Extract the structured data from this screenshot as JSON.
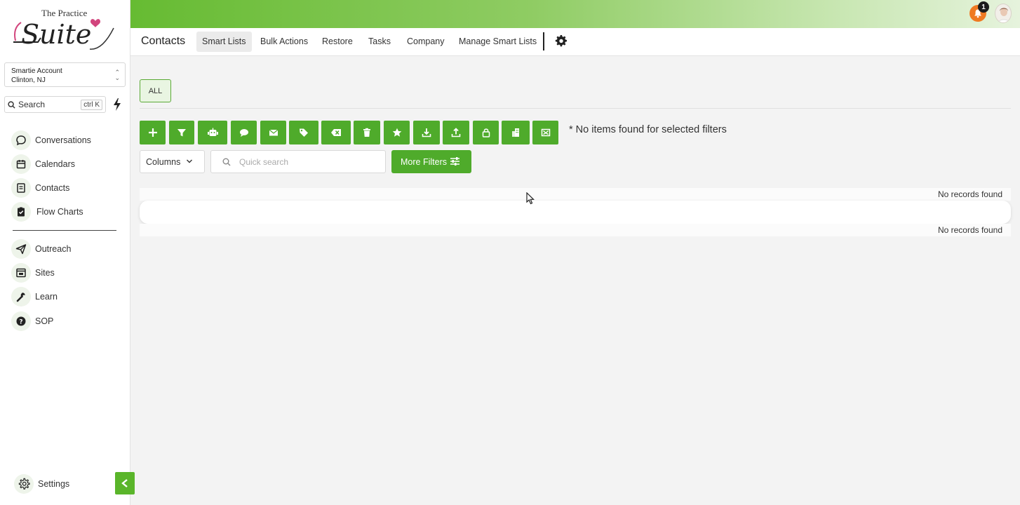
{
  "brand": {
    "logo_top_text": "The Practice",
    "logo_script_text": "Suite",
    "accent": "#4fab2b"
  },
  "account": {
    "name": "Smartie Account",
    "location": "Clinton, NJ"
  },
  "search": {
    "label": "Search",
    "shortcut": "ctrl K"
  },
  "sidebar": {
    "items": [
      {
        "label": "Conversations",
        "icon": "chat-bubble-icon"
      },
      {
        "label": "Calendars",
        "icon": "calendar-icon"
      },
      {
        "label": "Contacts",
        "icon": "contact-book-icon"
      },
      {
        "label": "Flow Charts",
        "icon": "clipboard-check-icon"
      },
      {
        "label": "Outreach",
        "icon": "paper-plane-icon"
      },
      {
        "label": "Sites",
        "icon": "browser-window-icon"
      },
      {
        "label": "Learn",
        "icon": "wrench-icon"
      },
      {
        "label": "SOP",
        "icon": "question-circle-icon"
      }
    ],
    "settings_label": "Settings"
  },
  "topbar": {
    "notification_count": "1"
  },
  "subnav": {
    "title": "Contacts",
    "tabs": [
      "Smart Lists",
      "Bulk Actions",
      "Restore",
      "Tasks",
      "Company",
      "Manage Smart Lists"
    ],
    "active_tab": "Smart Lists"
  },
  "main": {
    "all_label": "ALL",
    "toolbar_icons": [
      "plus-icon",
      "filter-icon",
      "robot-icon",
      "message-icon",
      "envelope-icon",
      "tag-icon",
      "remove-tag-icon",
      "trash-icon",
      "star-icon",
      "download-icon",
      "upload-icon",
      "lock-icon",
      "building-icon",
      "merge-icon"
    ],
    "no_items_text": "* No items found for selected filters",
    "columns_label": "Columns",
    "quick_search_placeholder": "Quick search",
    "more_filters_label": "More Filters",
    "records_top": "No records found",
    "records_bottom": "No records found"
  }
}
